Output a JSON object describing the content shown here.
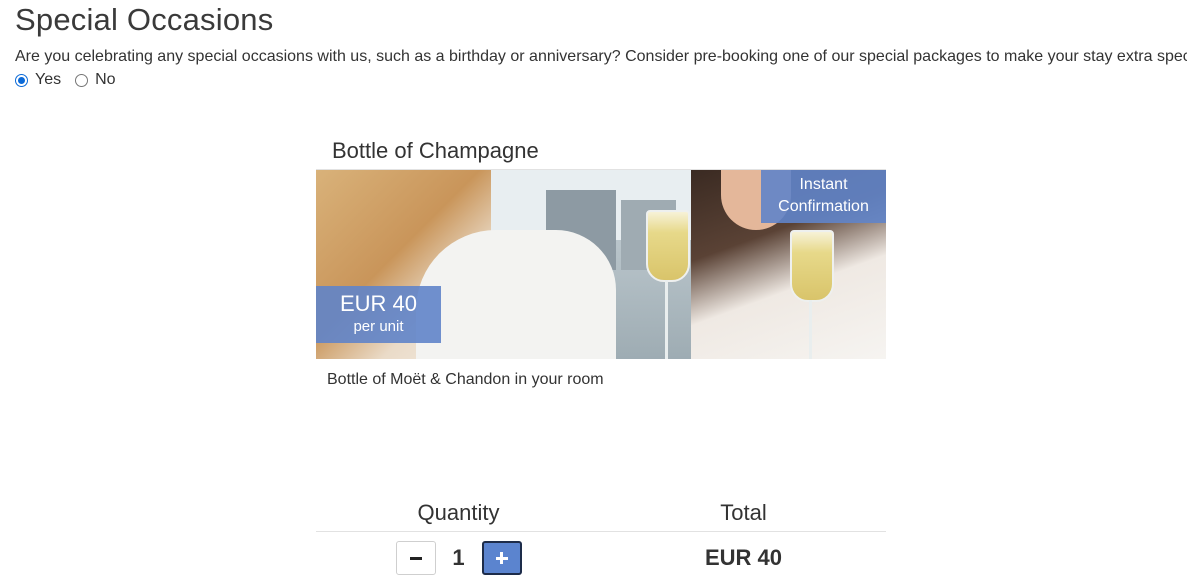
{
  "section": {
    "title": "Special Occasions",
    "intro": "Are you celebrating any special occasions with us, such as a birthday or anniversary? Consider pre-booking one of our special packages to make your stay extra special.",
    "options": [
      {
        "label": "Yes",
        "checked": true
      },
      {
        "label": "No",
        "checked": false
      }
    ]
  },
  "package": {
    "title": "Bottle of Champagne",
    "badge_confirmation": [
      "Instant",
      "Confirmation"
    ],
    "price_amount": "EUR 40",
    "price_unit": "per unit",
    "description": "Bottle of Moët & Chandon in your room"
  },
  "order": {
    "quantity_header": "Quantity",
    "total_header": "Total",
    "quantity": "1",
    "total": "EUR 40"
  },
  "colors": {
    "accent": "#6084c9",
    "radio_selected": "#0b6ad8"
  },
  "icons": {
    "minus": "minus-icon",
    "plus": "plus-icon"
  }
}
